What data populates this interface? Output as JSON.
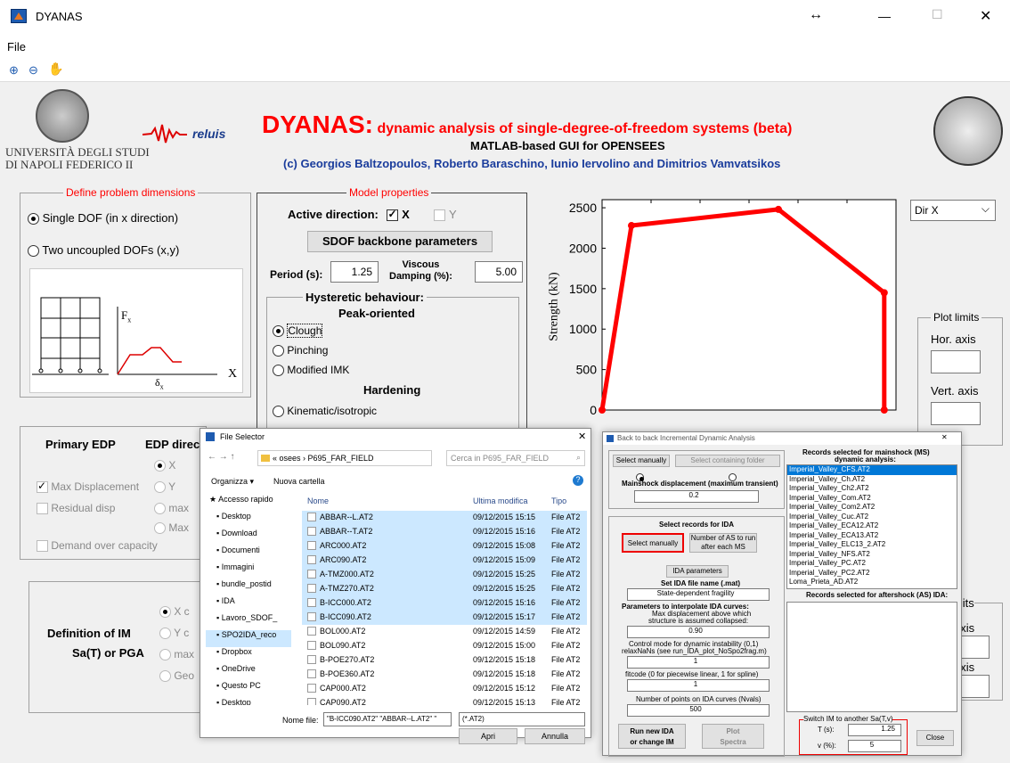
{
  "window": {
    "title": "DYANAS",
    "resize": "↔",
    "minimize": "—",
    "maximize": "☐",
    "close": "✕"
  },
  "menu": {
    "file": "File"
  },
  "header": {
    "title": "DYANAS:",
    "subtitle": " dynamic analysis of single-degree-of-freedom systems (beta)",
    "gui": "MATLAB-based GUI for OPENSEES",
    "credits": "(c) Georgios Baltzopoulos, Roberto Baraschino, Iunio Iervolino and Dimitrios Vamvatsikos",
    "univ1": "UNIVERSITÀ DEGLI STUDI",
    "univ2": "DI NAPOLI FEDERICO II",
    "reluis": "reluis"
  },
  "dims": {
    "legend": "Define problem dimensions",
    "single": "Single DOF (in x direction)",
    "two": "Two uncoupled DOFs (x,y)",
    "fx": "F",
    "fx_sub": "x",
    "dx": "δ",
    "dx_sub": "x",
    "x": "X"
  },
  "model": {
    "legend": "Model properties",
    "active": "Active direction:",
    "x": "X",
    "y": "Y",
    "backbone": "SDOF backbone parameters",
    "period_label": "Period (s):",
    "period": "1.25",
    "visc_label1": "Viscous",
    "visc_label2": "Damping (%):",
    "damping": "5.00",
    "hyst": "Hysteretic behaviour:",
    "peak": "Peak-oriented",
    "clough": "Clough",
    "pinching": "Pinching",
    "mimk": "Modified IMK",
    "hardening": "Hardening",
    "kinematic": "Kinematic/isotropic"
  },
  "plot": {
    "dir": "Dir X",
    "ylabel": "Strength (kN)",
    "yticks": [
      "2500",
      "2000",
      "1500",
      "1000",
      "500",
      "0"
    ],
    "limits_legend": "Plot limits",
    "hor": "Hor. axis",
    "vert": "Vert. axis",
    "limits2": "imits",
    "axis1": "axis",
    "axis2": "axis"
  },
  "chart_data": {
    "type": "line",
    "x": [
      0,
      0.05,
      0.3,
      0.48,
      0.48
    ],
    "y": [
      0,
      2280,
      2480,
      1450,
      0
    ],
    "ylabel": "Strength (kN)",
    "ylim": [
      0,
      2600
    ],
    "color": "#ff0000"
  },
  "edp": {
    "primary": "Primary EDP",
    "dir": "EDP direc",
    "x": "X",
    "y": "Y",
    "max1": "max",
    "max2": "Max",
    "maxdisp": "Max Displacement",
    "residual": "Residual disp",
    "demand": "Demand over capacity"
  },
  "im": {
    "title": "Definition of IM",
    "sub": "Sa(T) or PGA",
    "xc": "X c",
    "yc": "Y c",
    "max": "max",
    "geo": "Geo"
  },
  "fs": {
    "title": "File Selector",
    "path": "« osees › P695_FAR_FIELD",
    "search": "Cerca in P695_FAR_FIELD",
    "organize": "Organizza ▾",
    "newfolder": "Nuova cartella",
    "col_name": "Nome",
    "col_date": "Ultima modifica",
    "col_type": "Tipo",
    "nav": [
      "Accesso rapido",
      "Desktop",
      "Download",
      "Documenti",
      "Immagini",
      "bundle_postid",
      "IDA",
      "Lavoro_SDOF_",
      "SPO2IDA_reco",
      "Dropbox",
      "OneDrive",
      "Questo PC",
      "Desktop"
    ],
    "files": [
      [
        "ABBAR--L.AT2",
        "09/12/2015 15:15",
        "File AT2"
      ],
      [
        "ABBAR--T.AT2",
        "09/12/2015 15:16",
        "File AT2"
      ],
      [
        "ARC000.AT2",
        "09/12/2015 15:08",
        "File AT2"
      ],
      [
        "ARC090.AT2",
        "09/12/2015 15:09",
        "File AT2"
      ],
      [
        "A-TMZ000.AT2",
        "09/12/2015 15:25",
        "File AT2"
      ],
      [
        "A-TMZ270.AT2",
        "09/12/2015 15:25",
        "File AT2"
      ],
      [
        "B-ICC000.AT2",
        "09/12/2015 15:16",
        "File AT2"
      ],
      [
        "B-ICC090.AT2",
        "09/12/2015 15:17",
        "File AT2"
      ],
      [
        "BOL000.AT2",
        "09/12/2015 14:59",
        "File AT2"
      ],
      [
        "BOL090.AT2",
        "09/12/2015 15:00",
        "File AT2"
      ],
      [
        "B-POE270.AT2",
        "09/12/2015 15:18",
        "File AT2"
      ],
      [
        "B-POE360.AT2",
        "09/12/2015 15:18",
        "File AT2"
      ],
      [
        "CAP000.AT2",
        "09/12/2015 15:12",
        "File AT2"
      ],
      [
        "CAP090.AT2",
        "09/12/2015 15:13",
        "File AT2"
      ]
    ],
    "filename_label": "Nome file:",
    "filename": "\"B-ICC090.AT2\" \"ABBAR--L.AT2\" \"",
    "filter": "(*.AT2)",
    "open": "Apri",
    "cancel": "Annulla"
  },
  "ida": {
    "title": "Back to back Incremental Dynamic Analysis",
    "sel_manual": "Select manually",
    "sel_folder": "Select containing folder",
    "ms_disp": "Mainshock displacement (maximum transient)",
    "ms_val": "0.2",
    "sel_records": "Select records for IDA",
    "sel_manual2": "Select manually",
    "num_as1": "Number of AS to run",
    "num_as2": "after each MS",
    "ida_params": "IDA parameters",
    "set_file": "Set IDA file name (.mat)",
    "state": "State-dependent fragility",
    "interp": "Parameters to interpolate IDA curves:",
    "maxdisp1": "Max displacement above which",
    "maxdisp2": "structure is assumed collapsed:",
    "maxdisp_val": "0.90",
    "ctrl1": "Control mode for dynamic instability (0,1)",
    "ctrl2": "relaxNaNs (see run_IDA_plot_NoSpo2frag.m)",
    "ctrl_val": "1",
    "fit": "fitcode (0 for piecewise linear, 1 for spline)",
    "fit_val": "1",
    "npts": "Number of points on IDA curves (Nvals)",
    "npts_val": "500",
    "run1": "Run new IDA",
    "run2": "or change IM",
    "plot1": "Plot",
    "plot2": "Spectra",
    "ms_rec1": "Records selected for mainshock (MS)",
    "ms_rec2": "dynamic analysis:",
    "records": [
      "Imperial_Valley_CFS.AT2",
      "Imperial_Valley_Ch.AT2",
      "Imperial_Valley_Ch2.AT2",
      "Imperial_Valley_Com.AT2",
      "Imperial_Valley_Com2.AT2",
      "Imperial_Valley_Cuc.AT2",
      "Imperial_Valley_ECA12.AT2",
      "Imperial_Valley_ECA13.AT2",
      "Imperial_Valley_ELC13_2.AT2",
      "Imperial_Valley_NFS.AT2",
      "Imperial_Valley_PC.AT2",
      "Imperial_Valley_PC2.AT2",
      "Loma_Prieta_AD.AT2"
    ],
    "as_rec": "Records selected for aftershock (AS) IDA:",
    "switch": "Switch IM to another Sa(T,v)",
    "t_label": "T (s):",
    "t_val": "1.25",
    "v_label": "v (%):",
    "v_val": "5",
    "close": "Close"
  }
}
